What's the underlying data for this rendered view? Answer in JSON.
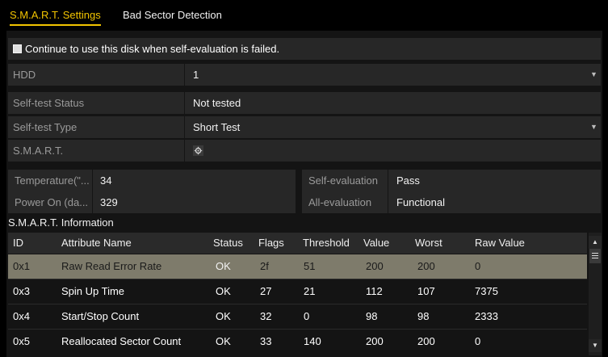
{
  "tabs": {
    "smart_settings": "S.M.A.R.T. Settings",
    "bad_sector": "Bad Sector Detection"
  },
  "continue_option": {
    "label": "Continue to use this disk when self-evaluation is failed."
  },
  "hdd": {
    "label": "HDD",
    "value": "1"
  },
  "selftest_status": {
    "label": "Self-test Status",
    "value": "Not tested"
  },
  "selftest_type": {
    "label": "Self-test Type",
    "value": "Short Test"
  },
  "smart": {
    "label": "S.M.A.R.T.",
    "icon": "gear-icon"
  },
  "temperature": {
    "label": "Temperature(\"...",
    "value": "34"
  },
  "power_on": {
    "label": "Power On (da...",
    "value": "329"
  },
  "self_evaluation": {
    "label": "Self-evaluation",
    "value": "Pass"
  },
  "all_evaluation": {
    "label": "All-evaluation",
    "value": "Functional"
  },
  "smart_info": {
    "title": "S.M.A.R.T. Information",
    "columns": [
      "ID",
      "Attribute Name",
      "Status",
      "Flags",
      "Threshold",
      "Value",
      "Worst",
      "Raw Value"
    ],
    "rows": [
      [
        "0x1",
        "Raw Read Error Rate",
        "OK",
        "2f",
        "51",
        "200",
        "200",
        "0"
      ],
      [
        "0x3",
        "Spin Up Time",
        "OK",
        "27",
        "21",
        "112",
        "107",
        "7375"
      ],
      [
        "0x4",
        "Start/Stop Count",
        "OK",
        "32",
        "0",
        "98",
        "98",
        "2333"
      ],
      [
        "0x5",
        "Reallocated Sector Count",
        "OK",
        "33",
        "140",
        "200",
        "200",
        "0"
      ]
    ],
    "selected_row": 0
  },
  "colors": {
    "accent": "#f2c400",
    "selected_row": "#7e7b6b",
    "field_bg": "#272727"
  }
}
